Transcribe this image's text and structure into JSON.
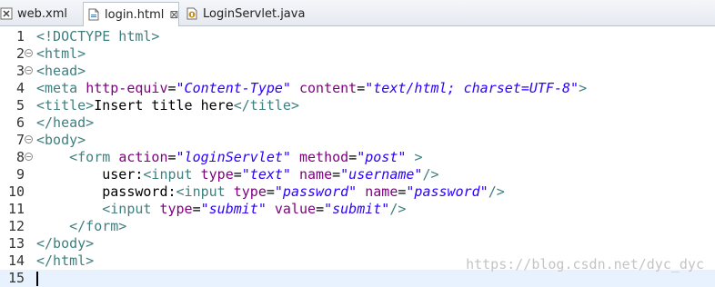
{
  "tabs": [
    {
      "label": "web.xml",
      "icon": "xml-file-icon",
      "active": false
    },
    {
      "label": "login.html",
      "icon": "html-file-icon",
      "active": true,
      "close": "⊠"
    },
    {
      "label": "LoginServlet.java",
      "icon": "java-file-icon",
      "active": false
    }
  ],
  "lines": [
    {
      "n": "1",
      "parts": [
        [
          "t",
          "<!DOCTYPE html>"
        ]
      ]
    },
    {
      "n": "2",
      "fold": "⊖",
      "parts": [
        [
          "t",
          "<html>"
        ]
      ]
    },
    {
      "n": "3",
      "fold": "⊖",
      "parts": [
        [
          "t",
          "<head>"
        ]
      ]
    },
    {
      "n": "4",
      "parts": [
        [
          "t",
          "<meta "
        ],
        [
          "a",
          "http-equiv"
        ],
        [
          "p",
          "="
        ],
        [
          "v",
          "\"Content-Type\""
        ],
        [
          "p",
          " "
        ],
        [
          "a",
          "content"
        ],
        [
          "p",
          "="
        ],
        [
          "v",
          "\"text/html; charset=UTF-8\""
        ],
        [
          "t",
          ">"
        ]
      ]
    },
    {
      "n": "5",
      "parts": [
        [
          "t",
          "<title>"
        ],
        [
          "p",
          "Insert title here"
        ],
        [
          "t",
          "</title>"
        ]
      ]
    },
    {
      "n": "6",
      "parts": [
        [
          "t",
          "</head>"
        ]
      ]
    },
    {
      "n": "7",
      "fold": "⊖",
      "parts": [
        [
          "t",
          "<body>"
        ]
      ]
    },
    {
      "n": "8",
      "fold": "⊖",
      "parts": [
        [
          "p",
          "    "
        ],
        [
          "t",
          "<form "
        ],
        [
          "a",
          "action"
        ],
        [
          "p",
          "="
        ],
        [
          "v",
          "\"loginServlet\""
        ],
        [
          "p",
          " "
        ],
        [
          "a",
          "method"
        ],
        [
          "p",
          "="
        ],
        [
          "v",
          "\"post\""
        ],
        [
          "p",
          " "
        ],
        [
          "t",
          ">"
        ]
      ]
    },
    {
      "n": "9",
      "parts": [
        [
          "p",
          "        user:"
        ],
        [
          "t",
          "<input "
        ],
        [
          "a",
          "type"
        ],
        [
          "p",
          "="
        ],
        [
          "v",
          "\"text\""
        ],
        [
          "p",
          " "
        ],
        [
          "a",
          "name"
        ],
        [
          "p",
          "="
        ],
        [
          "v",
          "\"username\""
        ],
        [
          "t",
          "/>"
        ]
      ]
    },
    {
      "n": "10",
      "parts": [
        [
          "p",
          "        password:"
        ],
        [
          "t",
          "<input "
        ],
        [
          "a",
          "type"
        ],
        [
          "p",
          "="
        ],
        [
          "v",
          "\"password\""
        ],
        [
          "p",
          " "
        ],
        [
          "a",
          "name"
        ],
        [
          "p",
          "="
        ],
        [
          "v",
          "\"password\""
        ],
        [
          "t",
          "/>"
        ]
      ]
    },
    {
      "n": "11",
      "parts": [
        [
          "p",
          "        "
        ],
        [
          "t",
          "<input "
        ],
        [
          "a",
          "type"
        ],
        [
          "p",
          "="
        ],
        [
          "v",
          "\"submit\""
        ],
        [
          "p",
          " "
        ],
        [
          "a",
          "value"
        ],
        [
          "p",
          "="
        ],
        [
          "v",
          "\"submit\""
        ],
        [
          "t",
          "/>"
        ]
      ]
    },
    {
      "n": "12",
      "parts": [
        [
          "p",
          "    "
        ],
        [
          "t",
          "</form>"
        ]
      ]
    },
    {
      "n": "13",
      "parts": [
        [
          "t",
          "</body>"
        ]
      ]
    },
    {
      "n": "14",
      "parts": [
        [
          "t",
          "</html>"
        ]
      ]
    },
    {
      "n": "15",
      "parts": [],
      "current": true
    }
  ],
  "watermark": "https://blog.csdn.net/dyc_dyc"
}
